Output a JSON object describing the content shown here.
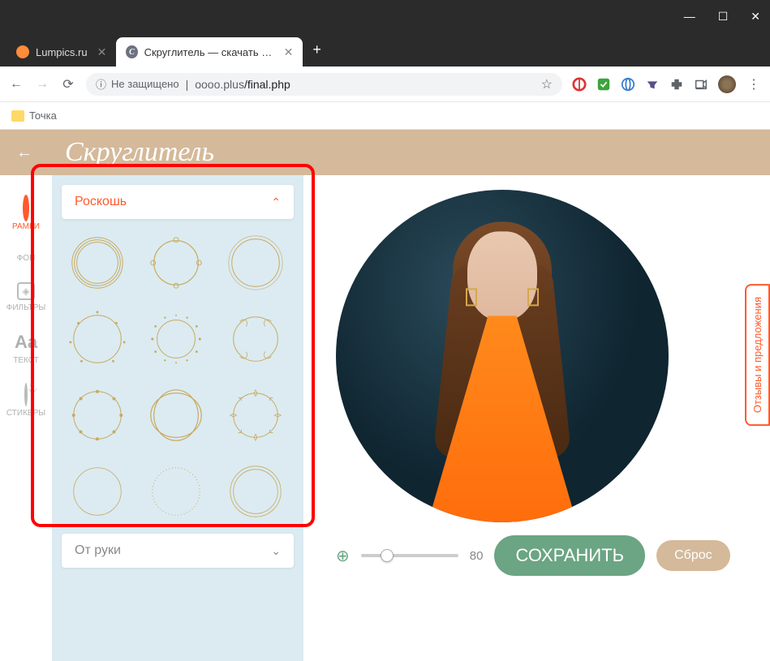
{
  "window": {
    "tabs": [
      {
        "title": "Lumpics.ru",
        "active": false
      },
      {
        "title": "Скруглитель — скачать круглук",
        "active": true
      }
    ]
  },
  "addressbar": {
    "security_label": "Не защищено",
    "url_host": "oooo.plus",
    "url_path": "/final.php"
  },
  "bookmarks": {
    "item1": "Точка"
  },
  "app": {
    "title": "Скруглитель",
    "sidebar": {
      "tabs": [
        {
          "id": "frames",
          "label": "РАМКИ",
          "active": true
        },
        {
          "id": "background",
          "label": "ФОН",
          "active": false
        },
        {
          "id": "filters",
          "label": "ФИЛЬТРЫ",
          "active": false
        },
        {
          "id": "text",
          "label": "ТЕКСТ",
          "active": false
        },
        {
          "id": "stickers",
          "label": "СТИКЕРЫ",
          "active": false
        }
      ]
    },
    "panel": {
      "expanded_category": "Роскошь",
      "collapsed_category": "От руки"
    },
    "controls": {
      "zoom_value": "80",
      "save_label": "СОХРАНИТЬ",
      "reset_label": "Сброс"
    },
    "feedback_label": "Отзывы и предложения"
  }
}
